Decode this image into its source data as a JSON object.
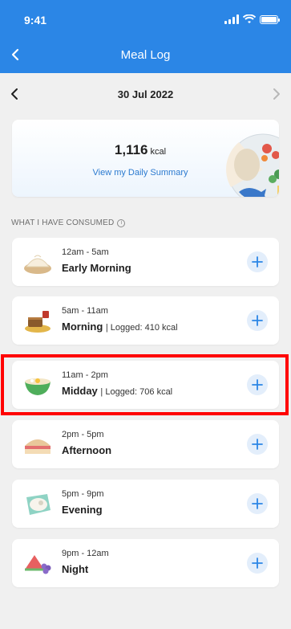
{
  "status_bar": {
    "time": "9:41"
  },
  "header": {
    "title": "Meal Log",
    "back_icon": "back-arrow-icon"
  },
  "date_nav": {
    "date": "30 Jul 2022"
  },
  "summary": {
    "kcal_value": "1,116",
    "kcal_unit": "kcal",
    "link_label": "View my Daily Summary"
  },
  "section": {
    "label": "WHAT I HAVE CONSUMED"
  },
  "meals": [
    {
      "time": "12am - 5am",
      "name": "Early Morning",
      "logged": ""
    },
    {
      "time": "5am - 11am",
      "name": "Morning",
      "logged": "| Logged: 410 kcal"
    },
    {
      "time": "11am - 2pm",
      "name": "Midday",
      "logged": "| Logged: 706 kcal"
    },
    {
      "time": "2pm - 5pm",
      "name": "Afternoon",
      "logged": ""
    },
    {
      "time": "5pm - 9pm",
      "name": "Evening",
      "logged": ""
    },
    {
      "time": "9pm - 12am",
      "name": "Night",
      "logged": ""
    }
  ],
  "colors": {
    "accent": "#2b86e6",
    "highlight": "#ff0000"
  }
}
